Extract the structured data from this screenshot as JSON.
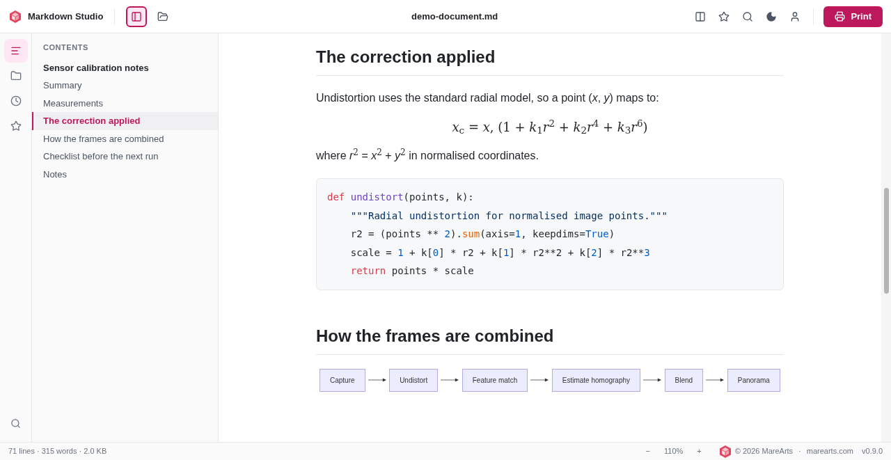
{
  "app": {
    "name": "Markdown Studio"
  },
  "toolbar_left": [
    {
      "selected": true
    },
    {
      "selected": false
    }
  ],
  "document_title": "demo-document.md",
  "print_button": "Print",
  "rail": [
    {
      "selected": true
    },
    {
      "selected": false
    },
    {
      "selected": false
    },
    {
      "selected": false
    }
  ],
  "toc": {
    "heading": "CONTENTS",
    "items": [
      {
        "label": "Sensor calibration notes",
        "kind": "title",
        "selected": false
      },
      {
        "label": "Summary",
        "kind": "section",
        "selected": false
      },
      {
        "label": "Measurements",
        "kind": "section",
        "selected": false
      },
      {
        "label": "The correction applied",
        "kind": "section",
        "selected": true
      },
      {
        "label": "How the frames are combined",
        "kind": "section",
        "selected": false
      },
      {
        "label": "Checklist before the next run",
        "kind": "section",
        "selected": false
      },
      {
        "label": "Notes",
        "kind": "section",
        "selected": false
      }
    ]
  },
  "document": [
    {
      "kind": "heading",
      "text": "The correction applied"
    },
    {
      "kind": "paragraph",
      "text": "Undistortion uses the standard radial model, so a point (*x*, *y*) maps to:"
    },
    {
      "kind": "math",
      "text": "*x*$_{c}$ = *x*, (1 + *k*$_{1}$*r*$^{2}$ + *k*$_{2}$*r*$^{4}$ + *k*$_{3}$*r*$^{6}$)"
    },
    {
      "kind": "paragraph",
      "text": "where *r*$^{2}$ = *x*$^{2}$ + *y*$^{2}$ in normalised coordinates."
    },
    {
      "kind": "code",
      "lines": [
        [
          {
            "kind": "keyword",
            "s": "def"
          },
          {
            "kind": "function",
            "s": " undistort"
          },
          {
            "kind": "plain",
            "s": "(points, k):"
          }
        ],
        [
          {
            "kind": "string",
            "s": "    \"\"\"Radial undistortion for normalised image points.\"\"\""
          }
        ],
        [
          {
            "kind": "plain",
            "s": "    r2 = (points ** "
          },
          {
            "kind": "number",
            "s": "2"
          },
          {
            "kind": "plain",
            "s": ")."
          },
          {
            "kind": "method",
            "s": "sum"
          },
          {
            "kind": "plain",
            "s": "(axis="
          },
          {
            "kind": "number",
            "s": "1"
          },
          {
            "kind": "plain",
            "s": ", keepdims="
          },
          {
            "kind": "number",
            "s": "True"
          },
          {
            "kind": "plain",
            "s": ")"
          }
        ],
        [
          {
            "kind": "plain",
            "s": "    scale = "
          },
          {
            "kind": "number",
            "s": "1"
          },
          {
            "kind": "plain",
            "s": " + k["
          },
          {
            "kind": "number",
            "s": "0"
          },
          {
            "kind": "plain",
            "s": "] * r2 + k["
          },
          {
            "kind": "number",
            "s": "1"
          },
          {
            "kind": "plain",
            "s": "] * r2**2 + k["
          },
          {
            "kind": "number",
            "s": "2"
          },
          {
            "kind": "plain",
            "s": "] * r2**"
          },
          {
            "kind": "number",
            "s": "3"
          }
        ],
        [
          {
            "kind": "keyword",
            "s": "    return"
          },
          {
            "kind": "plain",
            "s": " points * scale"
          }
        ]
      ]
    },
    {
      "kind": "heading",
      "text": "How the frames are combined"
    },
    {
      "kind": "flow",
      "nodes": [
        "Capture",
        "Undistort",
        "Feature match",
        "Estimate homography",
        "Blend",
        "Panorama"
      ]
    }
  ],
  "status_bar": {
    "stats": "71 lines · 315 words · 2.0 KB",
    "zoom_out": "−",
    "zoom": "110%",
    "zoom_in": "+",
    "copyright": "© 2026 MareArts",
    "separator": "·",
    "site": "marearts.com",
    "version": "v0.9.0"
  }
}
